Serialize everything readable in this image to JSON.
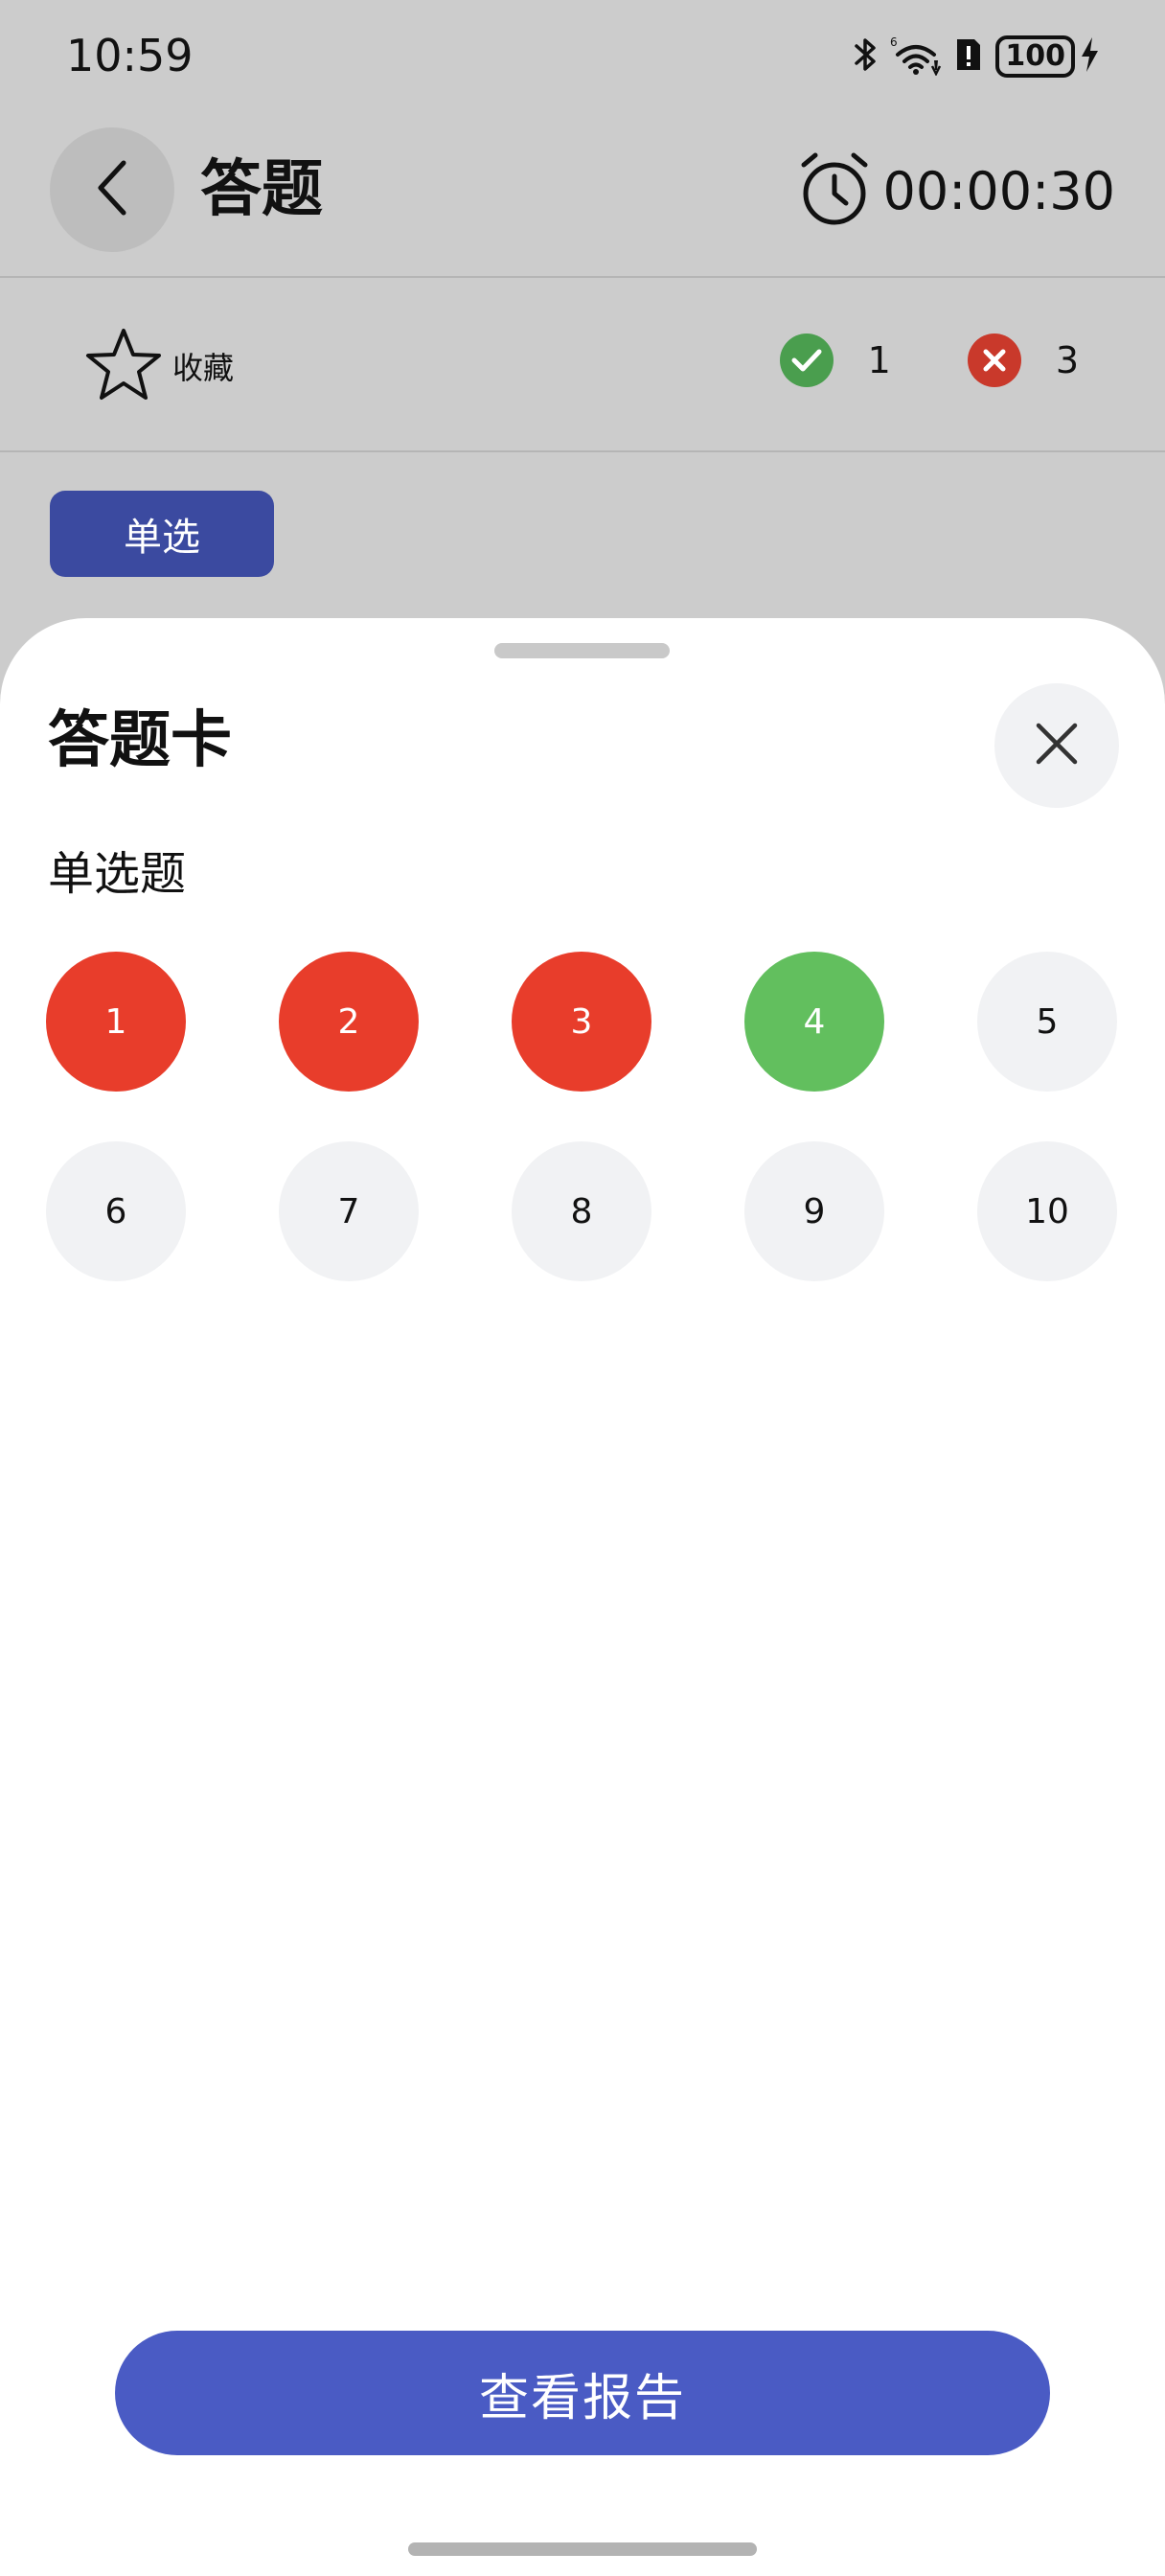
{
  "status_bar": {
    "time": "10:59",
    "battery": "100",
    "icons": [
      "bluetooth-icon",
      "wifi-icon",
      "alert-icon",
      "battery-icon",
      "charging-icon"
    ]
  },
  "header": {
    "title": "答题",
    "timer": "00:00:30",
    "back_icon": "chevron-left-icon",
    "timer_icon": "alarm-clock-icon"
  },
  "toolbar": {
    "favorite_label": "收藏",
    "favorite_icon": "star-icon",
    "correct_count": "1",
    "wrong_count": "3"
  },
  "question_type": "单选",
  "answer_sheet": {
    "title": "答题卡",
    "section_label": "单选题",
    "questions": [
      {
        "number": "1",
        "status": "wrong"
      },
      {
        "number": "2",
        "status": "wrong"
      },
      {
        "number": "3",
        "status": "wrong"
      },
      {
        "number": "4",
        "status": "correct"
      },
      {
        "number": "5",
        "status": "unanswered"
      },
      {
        "number": "6",
        "status": "unanswered"
      },
      {
        "number": "7",
        "status": "unanswered"
      },
      {
        "number": "8",
        "status": "unanswered"
      },
      {
        "number": "9",
        "status": "unanswered"
      },
      {
        "number": "10",
        "status": "unanswered"
      }
    ],
    "report_button": "查看报告"
  },
  "colors": {
    "wrong": "#e83d2b",
    "correct": "#62bf5e",
    "unanswered": "#f1f2f4",
    "primary": "#4a5bc4",
    "chip": "#3b4aa0"
  }
}
